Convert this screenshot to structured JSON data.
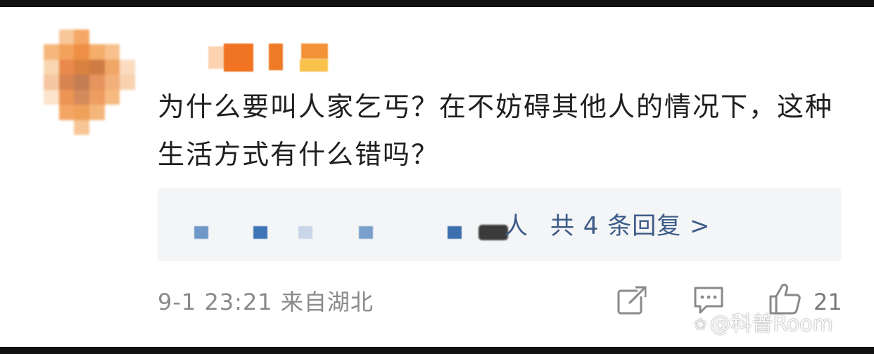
{
  "comment": {
    "text": "为什么要叫人家乞丐？在不妨碍其他人的情况下，这种生活方式有什么错吗？",
    "avatar_colors": [
      "#ffffff",
      "#f7c79a",
      "#f5a866",
      "#ffffff",
      "#ffffff",
      "#ffffff",
      "#f6b77d",
      "#f3a25b",
      "#ee8f45",
      "#f4ad6b",
      "#f7c08d",
      "#ffffff",
      "#f9d6b1",
      "#e9894b",
      "#d9823f",
      "#cf7c44",
      "#f0a766",
      "#fbdcc0",
      "#f6c6a0",
      "#d88450",
      "#c47d52",
      "#e5945d",
      "#f3b07a",
      "#f8d2ae",
      "#fce3cb",
      "#eb9454",
      "#d48a5b",
      "#ee9d61",
      "#f6b97f",
      "#ffffff",
      "#ffffff",
      "#f3a563",
      "#efa15c",
      "#f5b67c",
      "#ffffff",
      "#ffffff",
      "#ffffff",
      "#ffffff",
      "#f8c596",
      "#ffffff",
      "#ffffff",
      "#ffffff"
    ],
    "username_colors": [
      "#fbd3b0",
      "#f07422",
      "#ee7a25",
      "#f39236",
      "#f7c14a"
    ]
  },
  "replies": {
    "name_tail": "人",
    "summary": "共 4 条回复 >",
    "dot_colors": [
      "#6f97c7",
      "#3f74b6",
      "#c9d6e8",
      "#7aa0cc",
      "#3d6fb0"
    ]
  },
  "footer": {
    "timestamp": "9-1 23:21 来自湖北",
    "like_count": "21",
    "icons": [
      "share-icon",
      "comment-icon",
      "like-icon"
    ]
  },
  "watermark": {
    "logo": "❀",
    "text": "@科普Room"
  }
}
